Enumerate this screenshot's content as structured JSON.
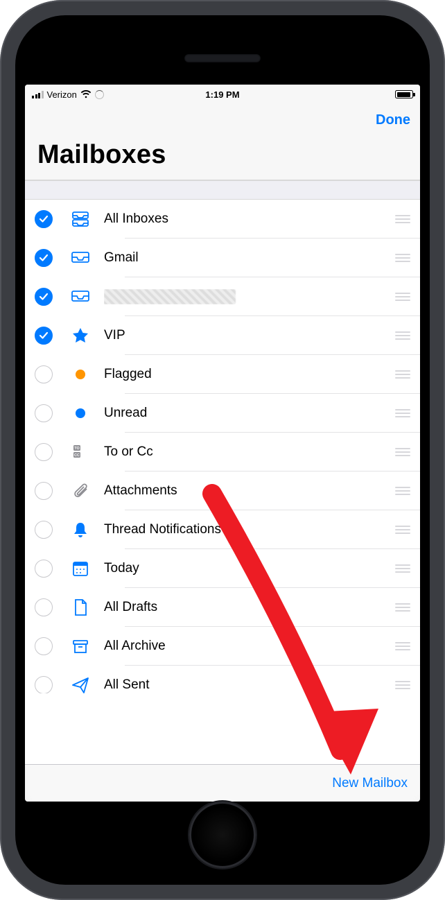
{
  "status_bar": {
    "carrier": "Verizon",
    "time": "1:19 PM"
  },
  "nav": {
    "done": "Done",
    "title": "Mailboxes"
  },
  "mailboxes": [
    {
      "id": "all-inboxes",
      "label": "All Inboxes",
      "checked": true,
      "icon": "all-inboxes-icon",
      "redacted": false
    },
    {
      "id": "gmail",
      "label": "Gmail",
      "checked": true,
      "icon": "inbox-icon",
      "redacted": false
    },
    {
      "id": "account2",
      "label": "",
      "checked": true,
      "icon": "inbox-icon",
      "redacted": true
    },
    {
      "id": "vip",
      "label": "VIP",
      "checked": true,
      "icon": "star-icon",
      "redacted": false
    },
    {
      "id": "flagged",
      "label": "Flagged",
      "checked": false,
      "icon": "flag-dot-icon",
      "redacted": false
    },
    {
      "id": "unread",
      "label": "Unread",
      "checked": false,
      "icon": "unread-dot-icon",
      "redacted": false
    },
    {
      "id": "to-cc",
      "label": "To or Cc",
      "checked": false,
      "icon": "to-cc-icon",
      "redacted": false
    },
    {
      "id": "attachments",
      "label": "Attachments",
      "checked": false,
      "icon": "paperclip-icon",
      "redacted": false
    },
    {
      "id": "thread",
      "label": "Thread Notifications",
      "checked": false,
      "icon": "bell-icon",
      "redacted": false
    },
    {
      "id": "today",
      "label": "Today",
      "checked": false,
      "icon": "calendar-icon",
      "redacted": false
    },
    {
      "id": "all-drafts",
      "label": "All Drafts",
      "checked": false,
      "icon": "draft-icon",
      "redacted": false
    },
    {
      "id": "all-archive",
      "label": "All Archive",
      "checked": false,
      "icon": "archive-icon",
      "redacted": false
    },
    {
      "id": "all-sent",
      "label": "All Sent",
      "checked": false,
      "icon": "sent-icon",
      "redacted": false
    }
  ],
  "toolbar": {
    "new_mailbox": "New Mailbox"
  },
  "annotation": {
    "arrow_color": "#ed1c24"
  }
}
